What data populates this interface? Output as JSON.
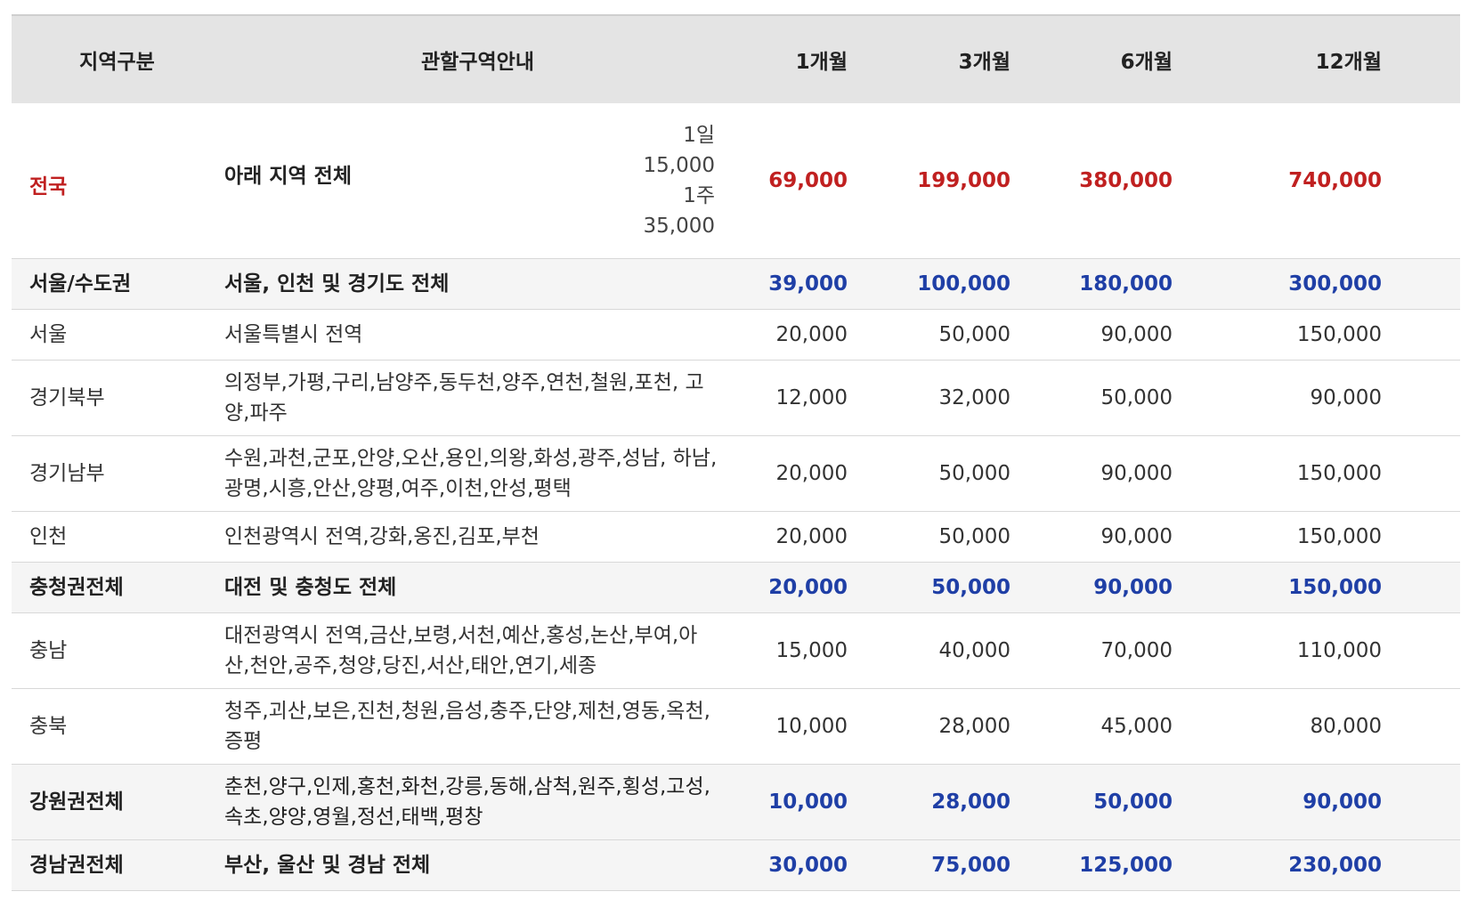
{
  "header": {
    "region": "지역구분",
    "area": "관할구역안내",
    "m1": "1개월",
    "m3": "3개월",
    "m6": "6개월",
    "m12": "12개월"
  },
  "rows": [
    {
      "region": "전국",
      "area": "아래 지역 전체",
      "day": "1일 15,000",
      "week": "1주 35,000",
      "m1": "69,000",
      "m3": "199,000",
      "m6": "380,000",
      "m12": "740,000"
    },
    {
      "region": "서울/수도권",
      "area": "서울, 인천 및 경기도 전체",
      "m1": "39,000",
      "m3": "100,000",
      "m6": "180,000",
      "m12": "300,000"
    },
    {
      "region": "서울",
      "area": "서울특별시 전역",
      "m1": "20,000",
      "m3": "50,000",
      "m6": "90,000",
      "m12": "150,000"
    },
    {
      "region": "경기북부",
      "area_1": "의정부,가평,구리,남양주,동두천,양주,연천,철원,포천, 고",
      "area_2": "양,파주",
      "m1": "12,000",
      "m3": "32,000",
      "m6": "50,000",
      "m12": "90,000"
    },
    {
      "region": "경기남부",
      "area_1": "수원,과천,군포,안양,오산,용인,의왕,화성,광주,성남, 하남,",
      "area_2": "광명,시흥,안산,양평,여주,이천,안성,평택",
      "m1": "20,000",
      "m3": "50,000",
      "m6": "90,000",
      "m12": "150,000"
    },
    {
      "region": "인천",
      "area": "인천광역시 전역,강화,옹진,김포,부천",
      "m1": "20,000",
      "m3": "50,000",
      "m6": "90,000",
      "m12": "150,000"
    },
    {
      "region": "충청권전체",
      "area": "대전 및 충청도 전체",
      "m1": "20,000",
      "m3": "50,000",
      "m6": "90,000",
      "m12": "150,000"
    },
    {
      "region": "충남",
      "area_1": "대전광역시 전역,금산,보령,서천,예산,홍성,논산,부여,아",
      "area_2": "산,천안,공주,청양,당진,서산,태안,연기,세종",
      "m1": "15,000",
      "m3": "40,000",
      "m6": "70,000",
      "m12": "110,000"
    },
    {
      "region": "충북",
      "area_1": "청주,괴산,보은,진천,청원,음성,충주,단양,제천,영동,옥천,",
      "area_2": "증평",
      "m1": "10,000",
      "m3": "28,000",
      "m6": "45,000",
      "m12": "80,000"
    },
    {
      "region": "강원권전체",
      "area_1": "춘천,양구,인제,홍천,화천,강릉,동해,삼척,원주,횡성,고성,",
      "area_2": "속초,양양,영월,정선,태백,평창",
      "m1": "10,000",
      "m3": "28,000",
      "m6": "50,000",
      "m12": "90,000"
    },
    {
      "region": "경남권전체",
      "area": "부산, 울산 및 경남 전체",
      "m1": "30,000",
      "m3": "75,000",
      "m6": "125,000",
      "m12": "230,000"
    }
  ],
  "colors": {
    "header_bg": "#e4e4e4",
    "group_bg": "#f5f5f5",
    "national_red": "#c02020",
    "group_blue": "#1f3fa6"
  }
}
